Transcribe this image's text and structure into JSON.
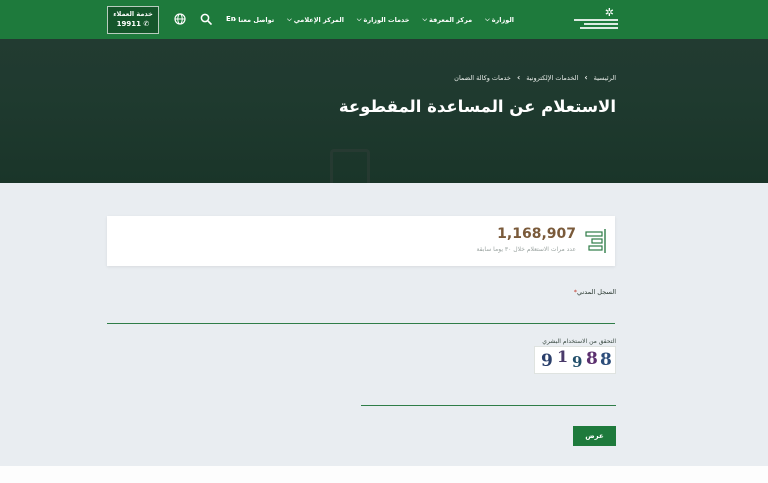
{
  "header": {
    "logo_alt": "وزارة الموارد البشرية والتنمية الاجتماعية",
    "nav": [
      {
        "label": "الوزارة",
        "has_dropdown": true
      },
      {
        "label": "مركز المعرفة",
        "has_dropdown": true
      },
      {
        "label": "خدمات الوزارة",
        "has_dropdown": true
      },
      {
        "label": "المركز الإعلامي",
        "has_dropdown": true
      },
      {
        "label": "تواصل معنا",
        "has_dropdown": true
      }
    ],
    "lang_toggle": "En",
    "customer_care": {
      "title": "خدمة العملاء",
      "phone": "19911"
    }
  },
  "hero": {
    "breadcrumb": [
      "الرئيسية",
      "الخدمات الإلكترونية",
      "خدمات وكالة الضمان"
    ],
    "title": "الاستعلام عن المساعدة المقطوعة"
  },
  "stats": {
    "count": "1,168,907",
    "label": "عدد مرات الاستعلام خلال ٣٠ يوما سابقة"
  },
  "form": {
    "civil_label": "السجل المدني",
    "civil_required_mark": "*",
    "civil_value": "",
    "captcha_label": "التحقق من الاستخدام البشري",
    "captcha_text": "91988",
    "captcha_value": "",
    "submit_label": "عرض"
  },
  "colors": {
    "brand_green": "#1e7a3c",
    "hero_dark": "#1f3a2f",
    "page_bg": "#e9edf1",
    "stat_number": "#7a5a3a"
  }
}
